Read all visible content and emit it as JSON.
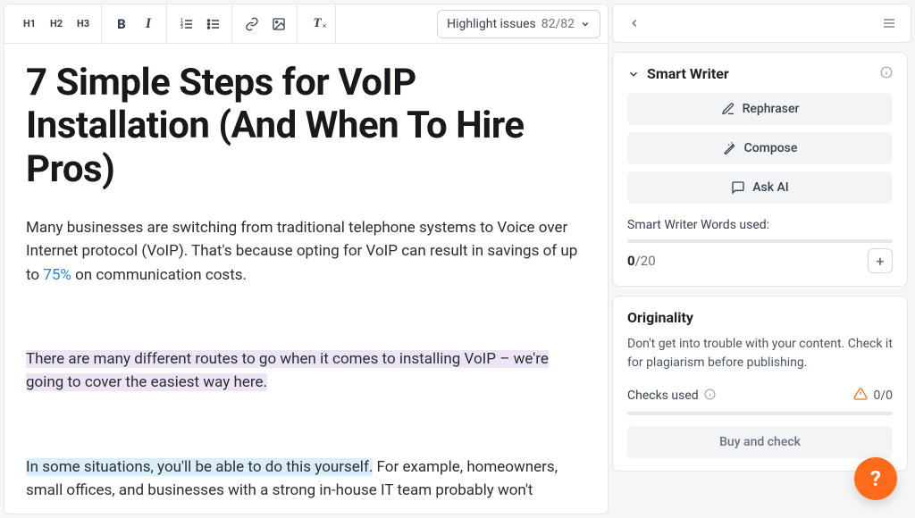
{
  "toolbar": {
    "h1": "H1",
    "h2": "H2",
    "h3": "H3",
    "highlight_label": "Highlight issues",
    "highlight_count": "82/82"
  },
  "document": {
    "title": "7 Simple Steps for VoIP Installation (And When To Hire Pros)",
    "p1_a": "Many businesses are switching from traditional telephone systems to Voice over Internet protocol (VoIP). That's because opting for VoIP can result in savings of up to ",
    "p1_link": "75%",
    "p1_b": " on communication costs.",
    "p2": "There are many different routes to go when it comes to installing VoIP – we're going to cover the easiest way here.",
    "p3_hl": "In some situations, you'll be able to do this yourself.",
    "p3_rest": " For example, homeowners, small offices, and businesses with a strong in-house IT team probably won't"
  },
  "sidebar": {
    "smart_writer": {
      "title": "Smart Writer",
      "rephraser": "Rephraser",
      "compose": "Compose",
      "ask_ai": "Ask AI",
      "words_label": "Smart Writer Words used:",
      "words_used": "0",
      "words_limit": "/20"
    },
    "originality": {
      "title": "Originality",
      "desc": "Don't get into trouble with your content. Check it for plagiarism before publishing.",
      "checks_label": "Checks used",
      "checks_count": "0/0",
      "buy_label": "Buy and check"
    }
  },
  "fab": "?"
}
